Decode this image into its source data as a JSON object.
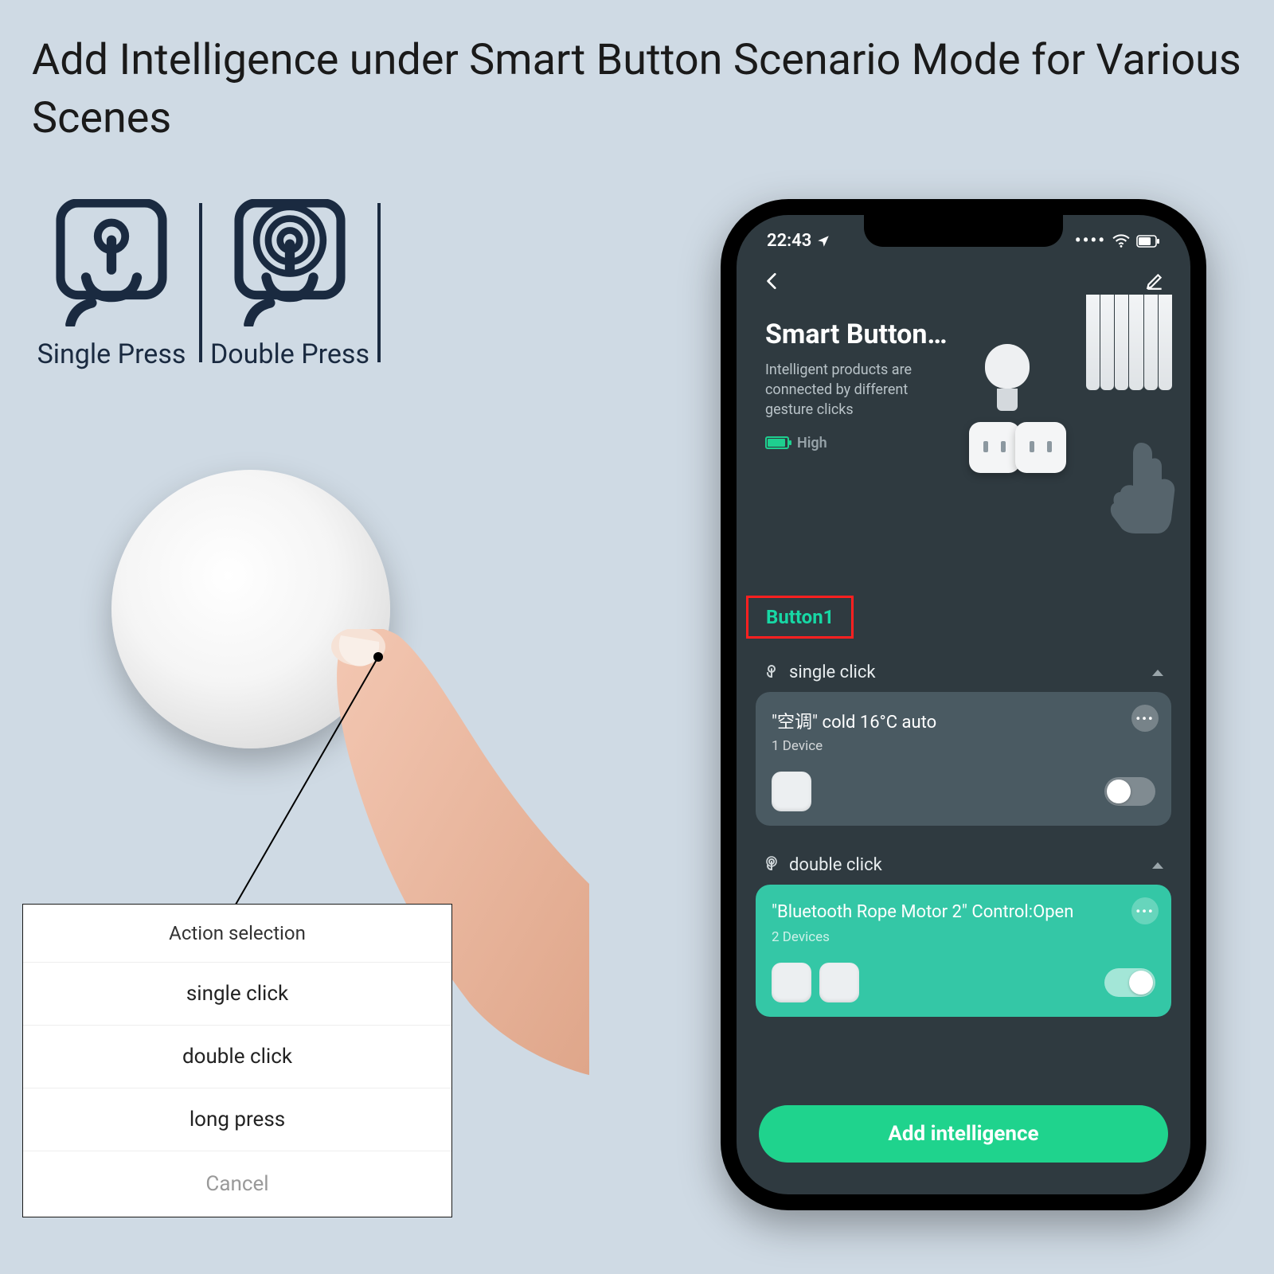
{
  "title": "Add Intelligence under Smart Button Scenario Mode for Various Scenes",
  "press_modes": {
    "single": "Single Press",
    "double": "Double Press"
  },
  "action_popup": {
    "title": "Action selection",
    "items": [
      "single click",
      "double click",
      "long press"
    ],
    "cancel": "Cancel"
  },
  "phone": {
    "status": {
      "time": "22:43",
      "location_icon": "location-arrow",
      "wifi": true,
      "battery_icon": true
    },
    "header": {
      "title": "Smart Button…",
      "subtitle": "Intelligent products are connected by different gesture clicks",
      "battery_level": "High"
    },
    "tab": "Button1",
    "sections": [
      {
        "key": "single",
        "label": "single click",
        "card": {
          "title": "\"空调\" cold 16°C auto",
          "subtitle": "1 Device",
          "device_count": 1,
          "toggle": false,
          "style": "dark"
        }
      },
      {
        "key": "double",
        "label": "double click",
        "card": {
          "title": "\"Bluetooth Rope Motor 2\" Control:Open",
          "subtitle": "2 Devices",
          "device_count": 2,
          "toggle": true,
          "style": "teal"
        }
      }
    ],
    "cta": "Add intelligence"
  }
}
